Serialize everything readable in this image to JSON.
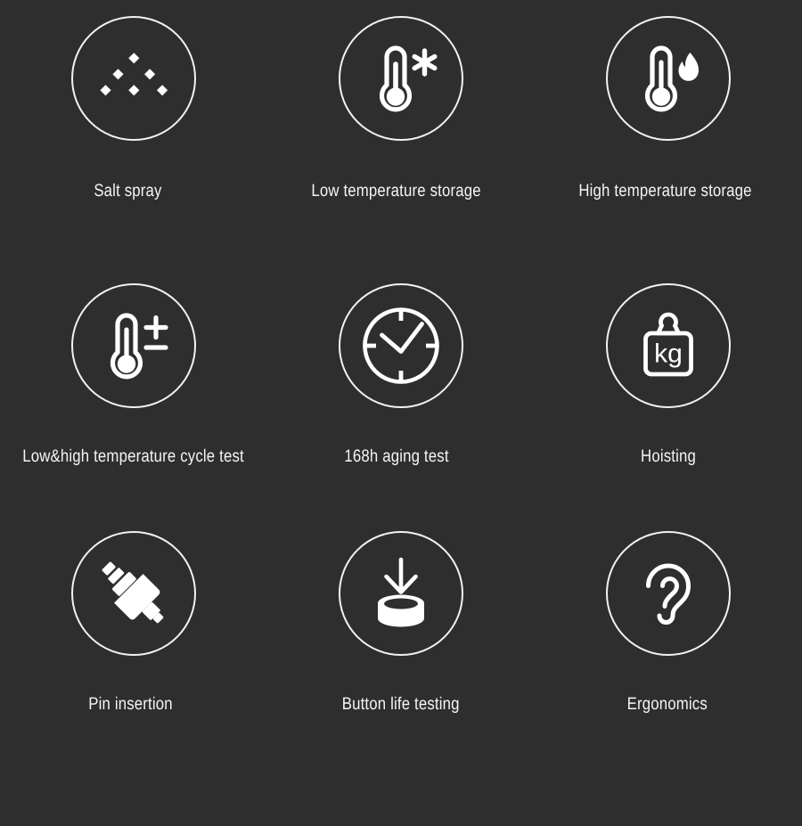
{
  "page": {
    "background_color": "#2e2e2e",
    "foreground_color": "#f5f5f5",
    "columns": 3,
    "rows": 3
  },
  "items": [
    {
      "id": "salt-spray",
      "label": "Salt spray",
      "icon": "salt-spray-droplets-icon",
      "row": 1,
      "column": 1
    },
    {
      "id": "low-temperature-storage",
      "label": "Low temperature storage",
      "icon": "thermometer-snowflake-icon",
      "row": 1,
      "column": 2
    },
    {
      "id": "high-temperature-storage",
      "label": "High temperature storage",
      "icon": "thermometer-flame-icon",
      "row": 1,
      "column": 3
    },
    {
      "id": "low-high-temperature-cycle-test",
      "label": "Low&high temperature cycle test",
      "icon": "thermometer-plus-minus-icon",
      "row": 2,
      "column": 1
    },
    {
      "id": "aging-test",
      "label": "168h aging test",
      "icon": "clock-icon",
      "row": 2,
      "column": 2
    },
    {
      "id": "hoisting",
      "label": "Hoisting",
      "icon": "kg-weight-icon",
      "icon_text": "kg",
      "row": 2,
      "column": 3
    },
    {
      "id": "pin-insertion",
      "label": "Pin insertion",
      "icon": "plug-connector-icon",
      "row": 3,
      "column": 1
    },
    {
      "id": "button-life-testing",
      "label": "Button life testing",
      "icon": "arrow-press-button-icon",
      "row": 3,
      "column": 2
    },
    {
      "id": "ergonomics",
      "label": "Ergonomics",
      "icon": "ear-icon",
      "row": 3,
      "column": 3
    }
  ]
}
